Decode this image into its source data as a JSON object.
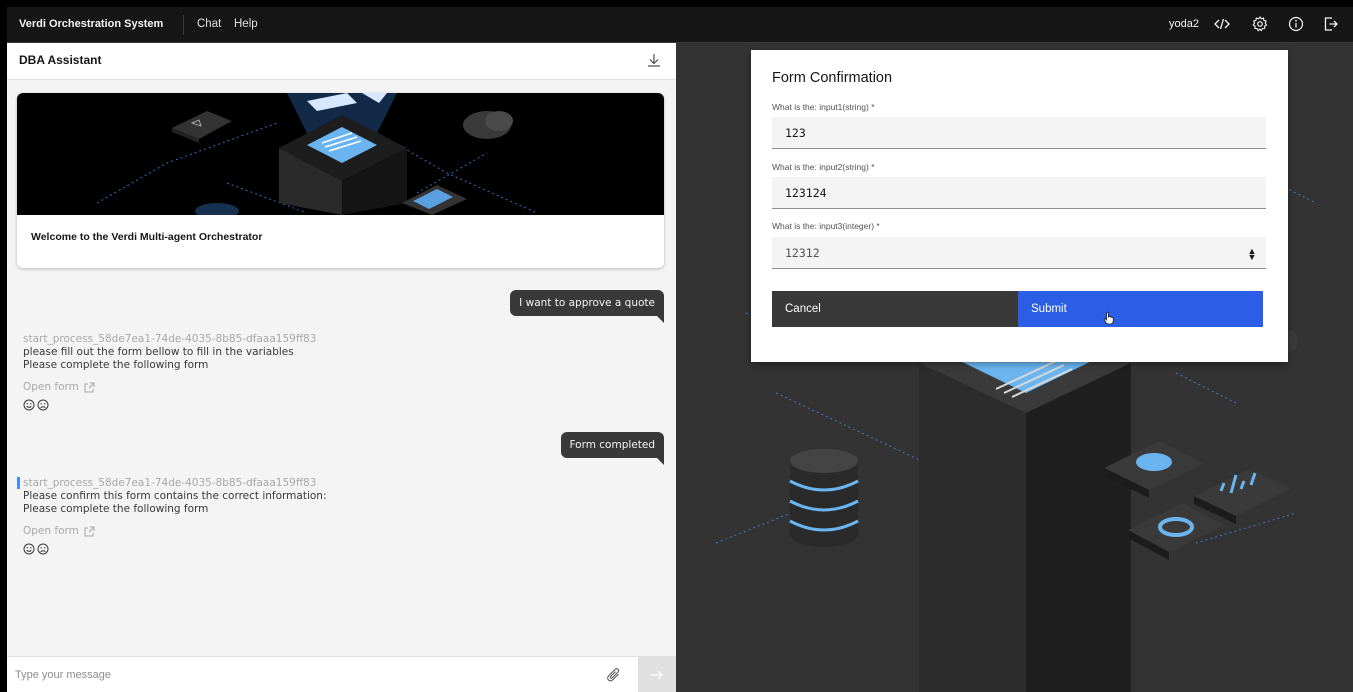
{
  "header": {
    "brand": "Verdi Orchestration System",
    "nav": [
      "Chat",
      "Help"
    ],
    "user": "yoda2",
    "icons": [
      "code-icon",
      "gear-icon",
      "info-icon",
      "logout-icon"
    ]
  },
  "panel": {
    "title": "DBA Assistant",
    "welcome": "Welcome to the Verdi Multi-agent Orchestrator"
  },
  "messages": [
    {
      "type": "user",
      "text": "I want to approve a quote"
    },
    {
      "type": "bot",
      "process_id": "start_process_58de7ea1-74de-4035-8b85-dfaaa159ff83",
      "line1": "please fill out the form bellow to fill in the variables",
      "line2": "Please complete the following form",
      "open_form": "Open form"
    },
    {
      "type": "user",
      "text": "Form completed"
    },
    {
      "type": "bot",
      "process_id": "start_process_58de7ea1-74de-4035-8b85-dfaaa159ff83",
      "line1": "Please confirm this form contains the correct information:",
      "line2": "Please complete the following form",
      "open_form": "Open form"
    }
  ],
  "composer": {
    "placeholder": "Type your message"
  },
  "modal": {
    "title": "Form Confirmation",
    "fields": [
      {
        "label": "What is the: input1(string) *",
        "value": "123"
      },
      {
        "label": "What is the: input2(string) *",
        "value": "123124"
      },
      {
        "label": "What is the: input3(integer) *",
        "value": "12312"
      }
    ],
    "cancel": "Cancel",
    "submit": "Submit"
  },
  "colors": {
    "accent": "#2b5de6",
    "header_bg": "#161616",
    "bubble_bg": "#393939",
    "right_bg": "#333333"
  }
}
